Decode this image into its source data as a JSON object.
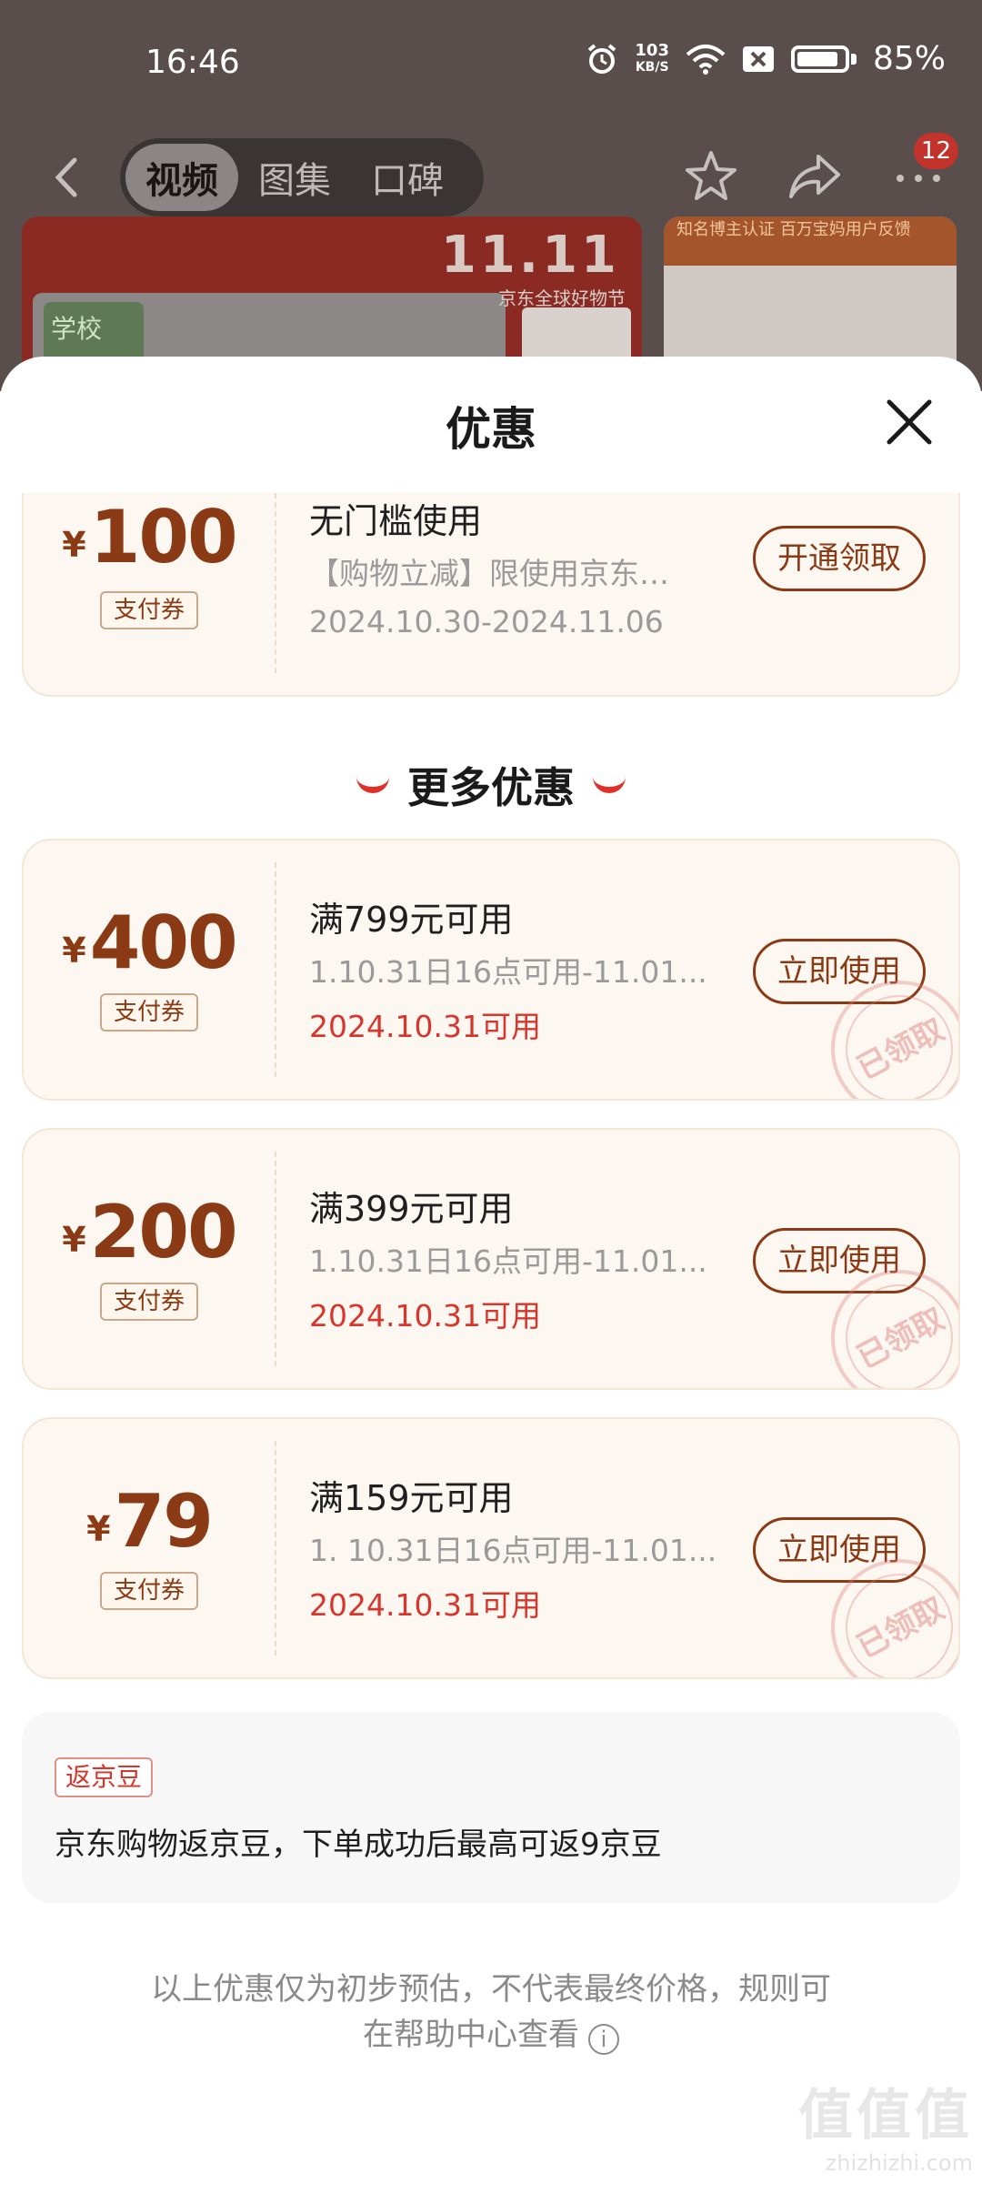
{
  "status_bar": {
    "time": "16:46",
    "net_speed_value": "103",
    "net_speed_unit": "KB/S",
    "battery": "85%"
  },
  "nav": {
    "tabs": [
      {
        "label": "视频"
      },
      {
        "label": "图集"
      },
      {
        "label": "口碑"
      }
    ],
    "badge_count": "12"
  },
  "banner": {
    "logo": "11.11",
    "festival": "京东全球好物节",
    "school_text": "学校",
    "right_heading": "知名博主认证 百万宝妈用户反馈"
  },
  "sheet": {
    "title": "优惠",
    "top_coupon": {
      "currency": "¥",
      "amount": "100",
      "tag": "支付券",
      "title": "无门槛使用",
      "desc": "【购物立减】限使用京东…",
      "date": "2024.10.30-2024.11.06",
      "button": "开通领取"
    },
    "more_title": "更多优惠",
    "coupons": [
      {
        "currency": "¥",
        "amount": "400",
        "tag": "支付券",
        "title": "满799元可用",
        "desc": "1.10.31日16点可用-11.01...",
        "date": "2024.10.31可用",
        "button": "立即使用",
        "stamp": "已领取"
      },
      {
        "currency": "¥",
        "amount": "200",
        "tag": "支付券",
        "title": "满399元可用",
        "desc": "1.10.31日16点可用-11.01...",
        "date": "2024.10.31可用",
        "button": "立即使用",
        "stamp": "已领取"
      },
      {
        "currency": "¥",
        "amount": "79",
        "tag": "支付券",
        "title": "满159元可用",
        "desc": "1. 10.31日16点可用-11.01...",
        "date": "2024.10.31可用",
        "button": "立即使用",
        "stamp": "已领取"
      }
    ],
    "beans": {
      "tag": "返京豆",
      "text": "京东购物返京豆，下单成功后最高可返9京豆"
    },
    "footnote_line1": "以上优惠仅为初步预估，不代表最终价格，规则可",
    "footnote_line2": "在帮助中心查看",
    "info_glyph": "i"
  },
  "watermark": {
    "big": "值值值",
    "small": "zhizhizhi.com"
  },
  "colors": {
    "accent_brown": "#8a3a14",
    "accent_red": "#d6362b",
    "coupon_bg": "#fdf7f1"
  }
}
